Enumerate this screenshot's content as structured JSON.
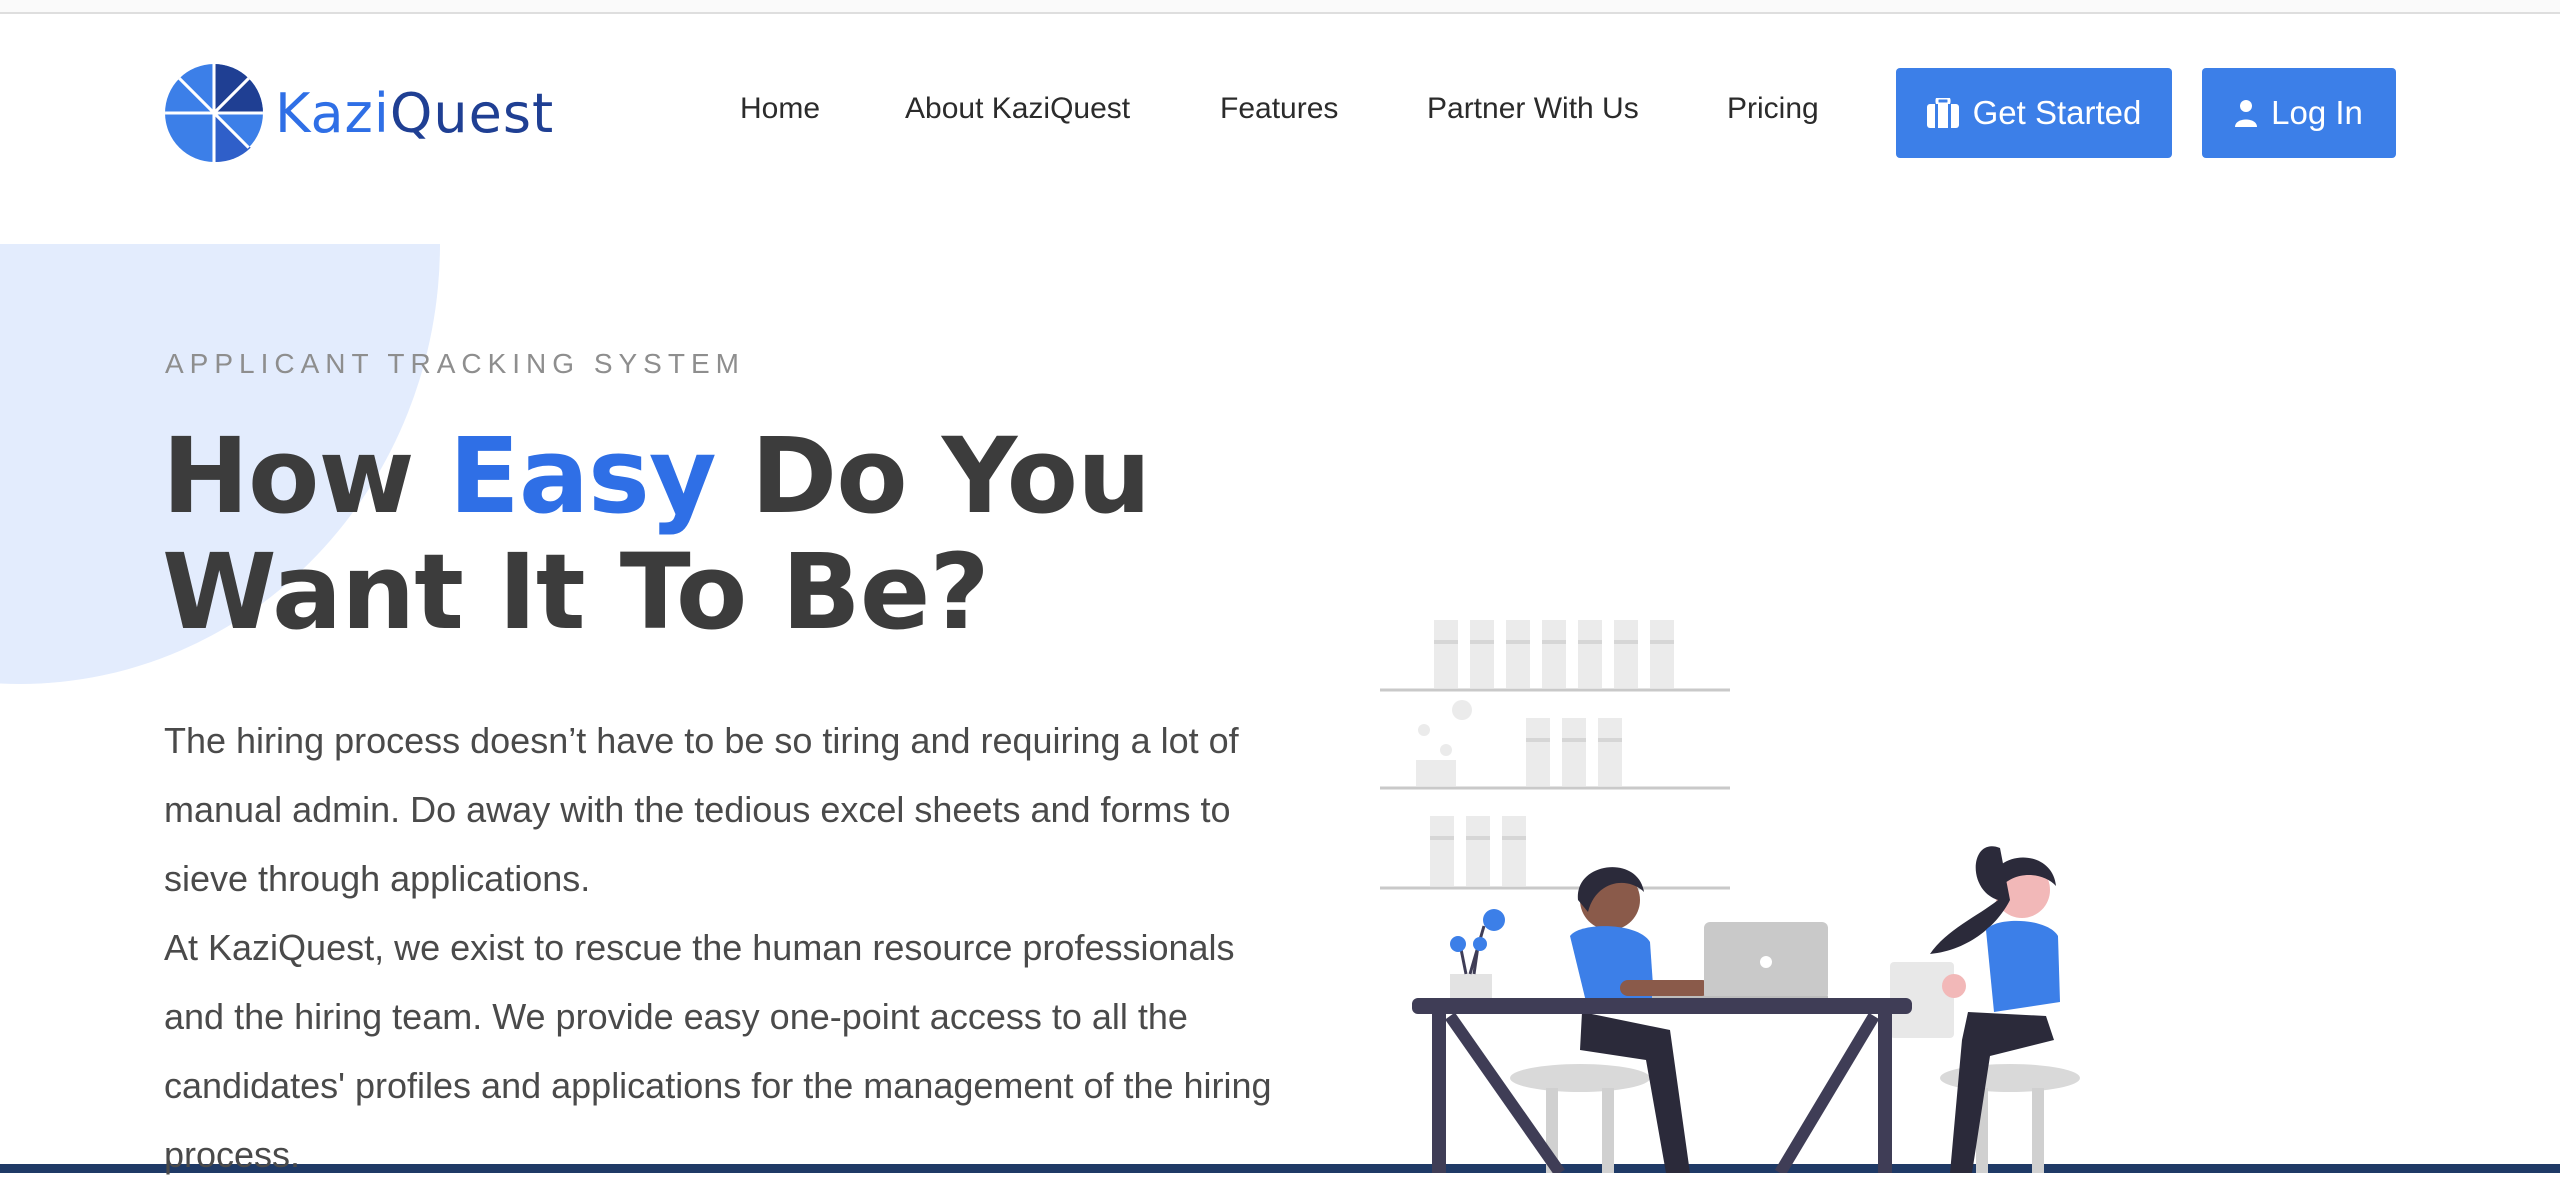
{
  "brand": {
    "name_part1": "Kazi",
    "name_part2": "Quest"
  },
  "nav": {
    "items": [
      {
        "label": "Home"
      },
      {
        "label": "About KaziQuest"
      },
      {
        "label": "Features"
      },
      {
        "label": "Partner With Us"
      },
      {
        "label": "Pricing"
      }
    ]
  },
  "actions": {
    "get_started": "Get Started",
    "login": "Log In"
  },
  "hero": {
    "eyebrow": "APPLICANT TRACKING SYSTEM",
    "headline_part1": "How ",
    "headline_accent": "Easy",
    "headline_part2": " Do You",
    "headline_line2": "Want It To Be?",
    "paragraph1": "The hiring process doesn’t have to be so tiring and requiring a lot of manual admin. Do away with the tedious excel sheets and forms to sieve through applications.",
    "paragraph2": "At KaziQuest, we exist to rescue the human resource professionals and the hiring team. We provide easy one-point access to all the candidates' profiles and applications for the management of the hiring process."
  },
  "colors": {
    "accent": "#2f6fe6",
    "button": "#3c7fe8",
    "brand_dark": "#1f3f93",
    "blob": "#e3ecfd"
  },
  "icons": {
    "get_started": "briefcase-icon",
    "login": "user-icon"
  }
}
